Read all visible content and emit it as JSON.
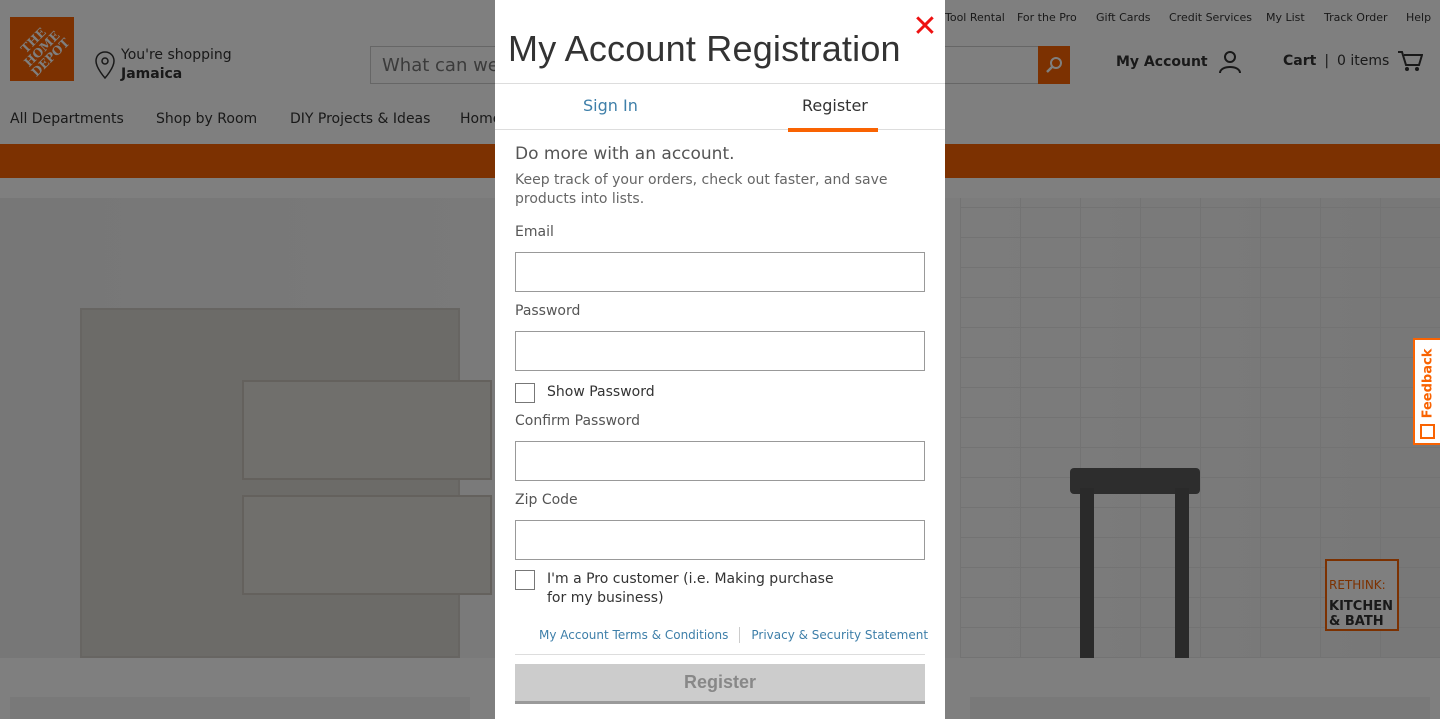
{
  "header": {
    "logo_text": "THE HOME DEPOT",
    "location_prefix": "You're shopping",
    "location_store": "Jamaica",
    "search_placeholder": "What can we h",
    "util_links": [
      "Tool Rental",
      "For the Pro",
      "Gift Cards",
      "Credit Services",
      "My List",
      "Track Order",
      "Help"
    ],
    "my_account": "My Account",
    "cart_label": "Cart",
    "cart_sep": "|",
    "cart_items": "0 items"
  },
  "nav": {
    "items": [
      "All Departments",
      "Shop by Room",
      "DIY Projects & Ideas",
      "Home"
    ]
  },
  "hero": {
    "badge_line1": "RETHINK:",
    "badge_line2": "KITCHEN",
    "badge_line3": "& BATH"
  },
  "feedback": {
    "label": "Feedback"
  },
  "modal": {
    "title": "My Account Registration",
    "close_glyph": "✕",
    "tabs": {
      "signin": "Sign In",
      "register": "Register"
    },
    "intro_heading": "Do more with an account.",
    "intro_text": "Keep track of your orders, check out faster, and save products into lists.",
    "fields": {
      "email_label": "Email",
      "password_label": "Password",
      "show_password": "Show Password",
      "confirm_label": "Confirm Password",
      "zip_label": "Zip Code",
      "pro_customer": "I'm a Pro customer (i.e. Making purchase for my business)"
    },
    "links": {
      "terms": "My Account Terms & Conditions",
      "privacy": "Privacy & Security Statement"
    },
    "register_button": "Register"
  },
  "colors": {
    "brand_orange": "#f96302",
    "link_blue": "#3e7fa9",
    "close_red": "#ee1111"
  }
}
